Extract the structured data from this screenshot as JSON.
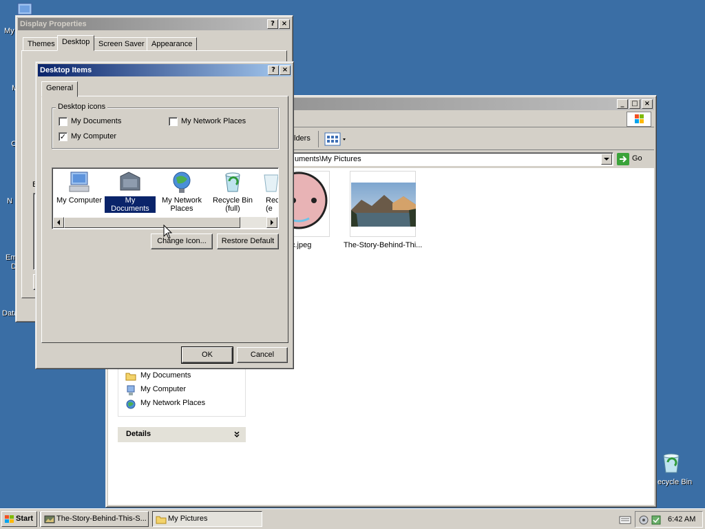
{
  "desktop": {
    "left_labels": [
      "My",
      "M",
      "C",
      "N",
      "Em",
      "D",
      "Data"
    ],
    "recycle_bin_label": "ecycle Bin"
  },
  "display_properties": {
    "title": "Display Properties",
    "tabs": [
      "Themes",
      "Desktop",
      "Screen Saver",
      "Appearance"
    ],
    "partial_label": "B"
  },
  "desktop_items": {
    "title": "Desktop Items",
    "tab": "General",
    "group_label": "Desktop icons",
    "checkboxes": [
      {
        "label": "My Documents",
        "checked": false
      },
      {
        "label": "My Computer",
        "checked": true
      },
      {
        "label": "My Network Places",
        "checked": false
      }
    ],
    "icons": [
      {
        "label": "My Computer",
        "icon": "my-computer-icon"
      },
      {
        "label": "My Documents",
        "icon": "my-documents-icon",
        "selected": true
      },
      {
        "label": "My Network Places",
        "icon": "my-network-places-icon"
      },
      {
        "label": "Recycle Bin (full)",
        "icon": "recycle-bin-full-icon"
      },
      {
        "label": "Rec (e",
        "icon": "recycle-bin-empty-icon"
      }
    ],
    "change_icon_label": "Change Icon...",
    "restore_default_label": "Restore Default",
    "ok_label": "OK",
    "cancel_label": "Cancel"
  },
  "explorer": {
    "toolbar_folders_label": "lders",
    "address_value": "uments\\My Pictures",
    "go_label": "Go",
    "files": [
      {
        "label": "c.jpeg"
      },
      {
        "label": "The-Story-Behind-Thi..."
      }
    ],
    "other_places": [
      "My Documents",
      "My Computer",
      "My Network Places"
    ],
    "details_label": "Details"
  },
  "taskbar": {
    "start_label": "Start",
    "tasks": [
      "The-Story-Behind-This-S...",
      "My Pictures"
    ],
    "clock": "6:42 AM"
  }
}
